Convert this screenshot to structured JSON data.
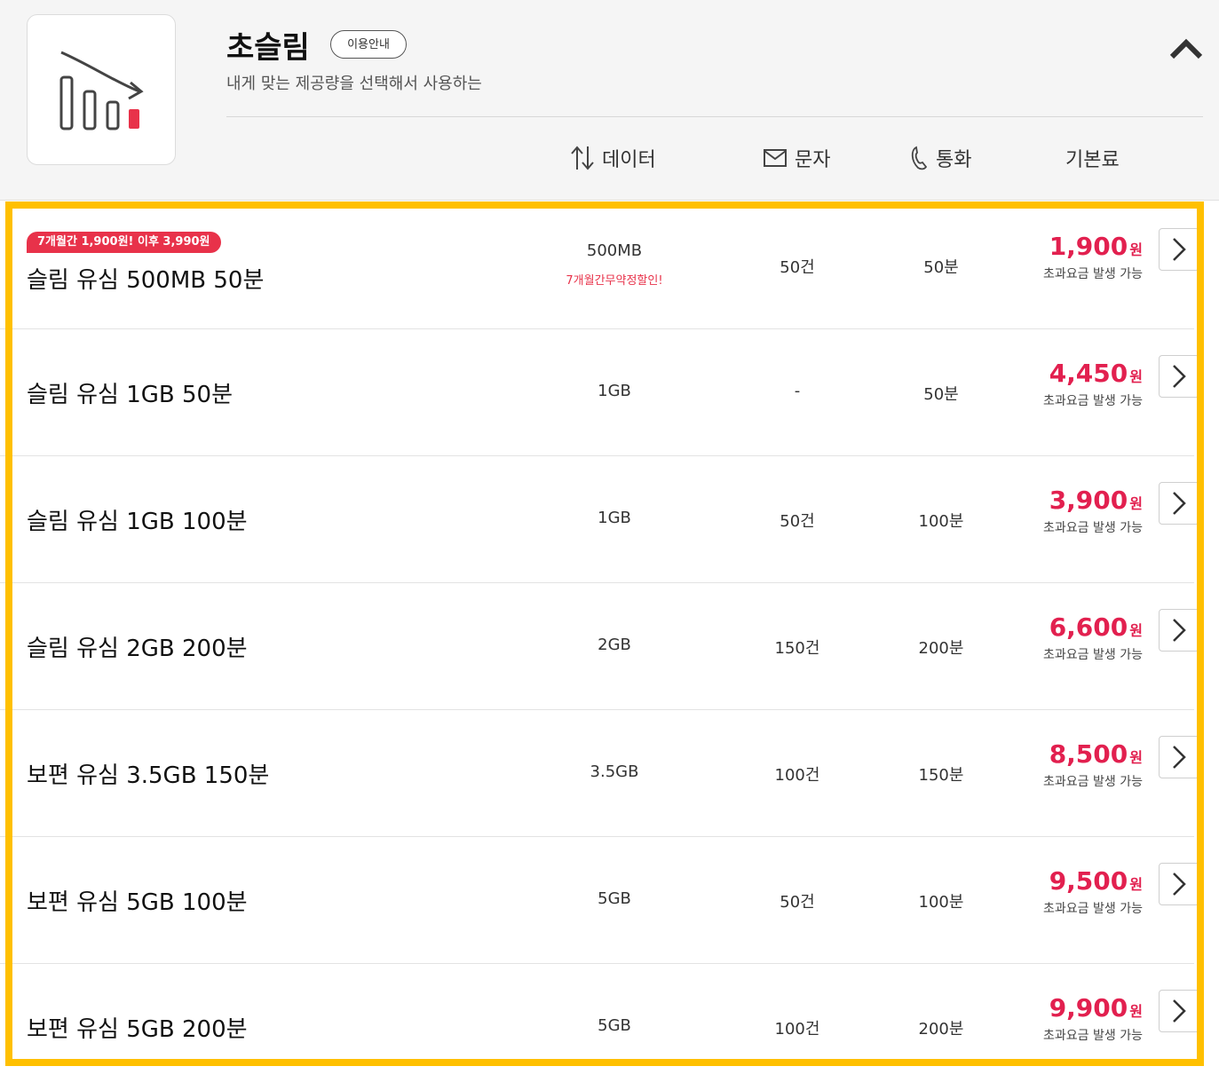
{
  "header": {
    "title": "초슬림",
    "info_button": "이용안내",
    "description": "내게 맞는 제공량을 선택해서 사용하는",
    "columns": {
      "data": "데이터",
      "sms": "문자",
      "call": "통화",
      "fee": "기본료"
    },
    "icons": {
      "logo": "chart-decrease-icon",
      "collapse": "chevron-up-icon",
      "data": "updown-arrows-icon",
      "sms": "envelope-icon",
      "call": "phone-icon"
    }
  },
  "plans": [
    {
      "name": "슬림 유심 500MB 50분",
      "data": "500MB",
      "data_note": "7개월간무약정할인!",
      "sms": "50건",
      "call": "50분",
      "price": "1,900",
      "currency": "원",
      "overage": "초과요금 발생 가능",
      "promo": "7개월간 1,900원! 이후 3,990원"
    },
    {
      "name": "슬림 유심 1GB 50분",
      "data": "1GB",
      "sms": "-",
      "call": "50분",
      "price": "4,450",
      "currency": "원",
      "overage": "초과요금 발생 가능"
    },
    {
      "name": "슬림 유심 1GB 100분",
      "data": "1GB",
      "sms": "50건",
      "call": "100분",
      "price": "3,900",
      "currency": "원",
      "overage": "초과요금 발생 가능"
    },
    {
      "name": "슬림 유심 2GB 200분",
      "data": "2GB",
      "sms": "150건",
      "call": "200분",
      "price": "6,600",
      "currency": "원",
      "overage": "초과요금 발생 가능"
    },
    {
      "name": "보편 유심 3.5GB 150분",
      "data": "3.5GB",
      "sms": "100건",
      "call": "150분",
      "price": "8,500",
      "currency": "원",
      "overage": "초과요금 발생 가능"
    },
    {
      "name": "보편 유심 5GB 100분",
      "data": "5GB",
      "sms": "50건",
      "call": "100분",
      "price": "9,500",
      "currency": "원",
      "overage": "초과요금 발생 가능"
    },
    {
      "name": "보편 유심 5GB 200분",
      "data": "5GB",
      "sms": "100건",
      "call": "200분",
      "price": "9,900",
      "currency": "원",
      "overage": "초과요금 발생 가능"
    }
  ],
  "colors": {
    "accent": "#e2204f",
    "promo": "#e8324a",
    "highlight_frame": "#ffc000"
  }
}
